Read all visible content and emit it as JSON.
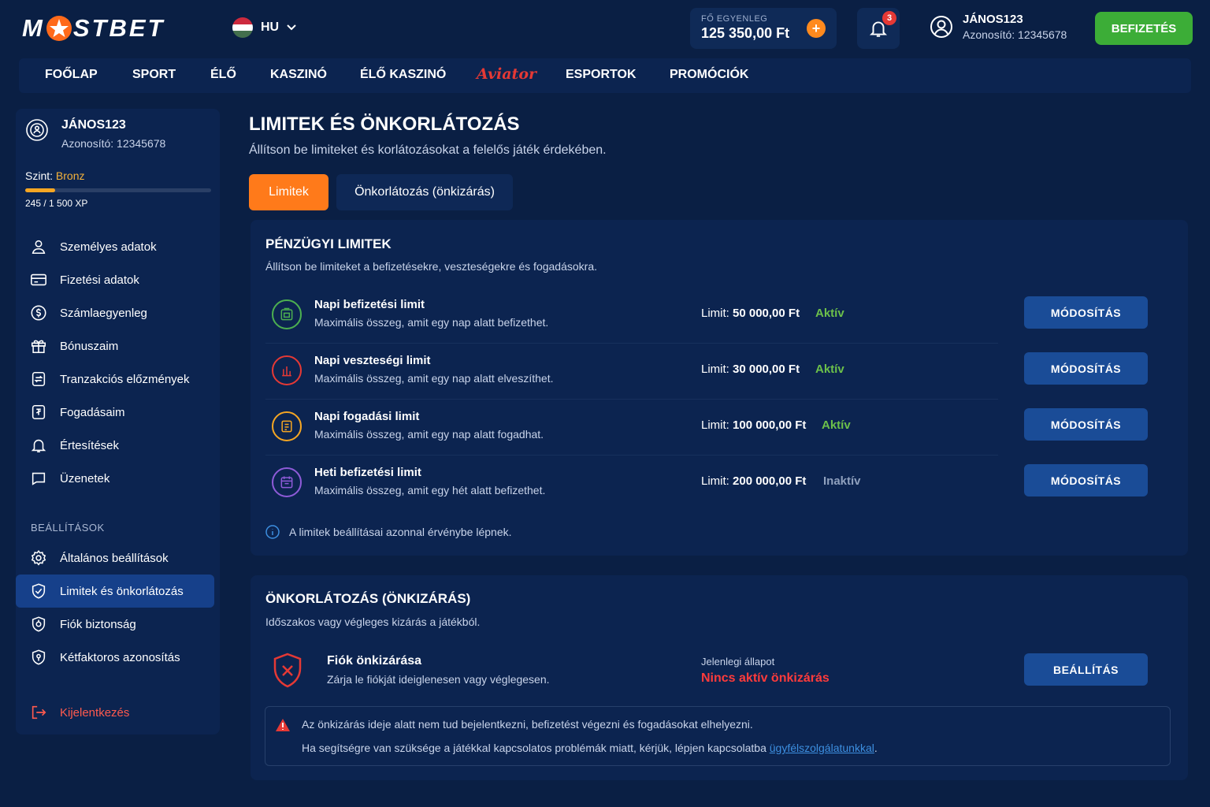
{
  "header": {
    "logo": {
      "left": "M",
      "right": "STBET"
    },
    "language": "HU",
    "balance_label": "FŐ EGYENLEG",
    "balance_value": "125 350,00 Ft",
    "notifications_count": "3",
    "user_name": "JÁNOS123",
    "user_id": "Azonosító: 12345678",
    "deposit_label": "BEFIZETÉS"
  },
  "nav": {
    "home": "FOŐLAP",
    "sport": "SPORT",
    "live": "ÉLŐ",
    "casino": "KASZINÓ",
    "live_casino": "ÉLŐ KASZINÓ",
    "aviator": "Aviator",
    "esports": "ESPORTOK",
    "promotions": "PROMÓCIÓK"
  },
  "sidebar": {
    "name": "JÁNOS123",
    "id": "Azonosító: 12345678",
    "level_label": "Szint:",
    "level_value": "Bronz",
    "xp_text": "245 / 1 500 XP",
    "xp_progress": 0.163,
    "items": [
      {
        "label": "Személyes adatok",
        "icon": "user-icon"
      },
      {
        "label": "Fizetési adatok",
        "icon": "card-icon"
      },
      {
        "label": "Számlaegyenleg",
        "icon": "coin-icon"
      },
      {
        "label": "Bónuszaim",
        "icon": "gift-icon"
      },
      {
        "label": "Tranzakciós előzmények",
        "icon": "transaction-icon"
      },
      {
        "label": "Fogadásaim",
        "icon": "ticket-icon"
      },
      {
        "label": "Értesítések",
        "icon": "bell-icon"
      },
      {
        "label": "Üzenetek",
        "icon": "chat-icon"
      }
    ],
    "settings_heading": "BEÁLLÍTÁSOK",
    "settings_items": [
      {
        "label": "Általános beállítások",
        "icon": "gear-icon"
      },
      {
        "label": "Limitek és önkorlátozás",
        "icon": "shield-check-icon",
        "active": true
      },
      {
        "label": "Fiók biztonság",
        "icon": "lock-shield-icon"
      },
      {
        "label": "Kétfaktoros azonosítás",
        "icon": "key-shield-icon"
      }
    ],
    "logout": "Kijelentkezés"
  },
  "main": {
    "title": "LIMITEK ÉS ÖNKORLÁTOZÁS",
    "subtitle": "Állítson be limiteket és korlátozásokat a felelős játék érdekében.",
    "tabs": [
      {
        "label": "Limitek",
        "active": true
      },
      {
        "label": "Önkorlátozás (önkizárás)",
        "active": false
      }
    ]
  },
  "financial": {
    "title": "PÉNZÜGYI LIMITEK",
    "subtitle": "Állítson be limiteket a befizetésekre, veszteségekre és fogadásokra.",
    "limit_prefix": "Limit:",
    "button_label": "MÓDOSÍTÁS",
    "rows": [
      {
        "name": "Napi befizetési limit",
        "desc": "Maximális összeg, amit egy nap alatt befizethet.",
        "amount": "50 000,00 Ft",
        "status": "Aktív",
        "active": true,
        "color": "#4caf50",
        "icon": "deposit-icon"
      },
      {
        "name": "Napi veszteségi limit",
        "desc": "Maximális összeg, amit egy nap alatt elveszíthet.",
        "amount": "30 000,00 Ft",
        "status": "Aktív",
        "active": true,
        "color": "#e53935",
        "icon": "loss-icon"
      },
      {
        "name": "Napi fogadási limit",
        "desc": "Maximális összeg, amit egy nap alatt fogadhat.",
        "amount": "100 000,00 Ft",
        "status": "Aktív",
        "active": true,
        "color": "#f5a623",
        "icon": "bet-icon"
      },
      {
        "name": "Heti befizetési limit",
        "desc": "Maximális összeg, amit egy hét alatt befizethet.",
        "amount": "200 000,00 Ft",
        "status": "Inaktív",
        "active": false,
        "color": "#8e5bd8",
        "icon": "calendar-icon"
      }
    ],
    "info": "A limitek beállításai azonnal érvénybe lépnek."
  },
  "self_exclusion": {
    "title": "ÖNKORLÁTOZÁS (ÖNKIZÁRÁS)",
    "subtitle": "Időszakos vagy végleges kizárás a játékból.",
    "row_title": "Fiók önkizárása",
    "row_desc": "Zárja le fiókját ideiglenesen vagy véglegesen.",
    "state_label": "Jelenlegi állapot",
    "state_value": "Nincs aktív önkizárás",
    "button_label": "BEÁLLÍTÁS",
    "warning_1": "Az önkizárás ideje alatt nem tud bejelentkezni, befizetést végezni és fogadásokat elhelyezni.",
    "warning_2": "Ha segítségre van szüksége a játékkal kapcsolatos problémák miatt, kérjük, lépjen kapcsolatba",
    "warning_link": "ügyfélszolgálatunkkal",
    "warning_end": "."
  },
  "colors": {
    "background": "#0a1f44",
    "panel": "#0c2450",
    "accent_orange": "#ff7a1a",
    "accent_green": "#3cad37",
    "button_blue": "#1a4c97",
    "danger": "#e53935"
  }
}
